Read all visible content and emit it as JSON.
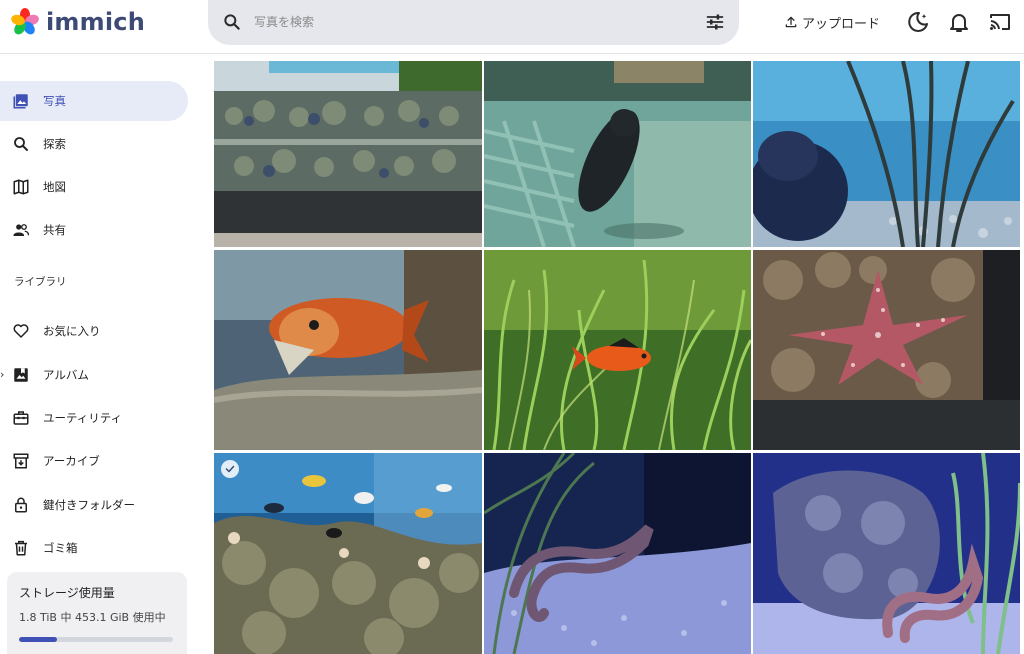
{
  "app": {
    "name": "immich"
  },
  "header": {
    "search_placeholder": "写真を検索",
    "upload_label": "アップロード",
    "icons": {
      "search": "search-icon",
      "filter": "tune-icon",
      "theme": "dark-mode-icon",
      "notifications": "bell-icon",
      "cast": "cast-icon"
    }
  },
  "sidebar": {
    "items": [
      {
        "label": "写真",
        "icon": "photos-icon",
        "active": true
      },
      {
        "label": "探索",
        "icon": "search-icon"
      },
      {
        "label": "地図",
        "icon": "map-icon"
      },
      {
        "label": "共有",
        "icon": "sharing-icon"
      }
    ],
    "library_heading": "ライブラリ",
    "library_items": [
      {
        "label": "お気に入り",
        "icon": "heart-icon"
      },
      {
        "label": "アルバム",
        "icon": "album-icon",
        "expandable": true
      },
      {
        "label": "ユーティリティ",
        "icon": "toolbox-icon"
      },
      {
        "label": "アーカイブ",
        "icon": "archive-icon"
      },
      {
        "label": "鍵付きフォルダー",
        "icon": "lock-icon"
      },
      {
        "label": "ゴミ箱",
        "icon": "trash-icon"
      }
    ],
    "storage": {
      "title": "ストレージ使用量",
      "usage": "1.8 TiB 中 453.1 GiB 使用中",
      "fraction": 0.245
    }
  },
  "photos": [
    {
      "subject": "coral-tanks",
      "selected": false
    },
    {
      "subject": "seal-swimming",
      "selected": false
    },
    {
      "subject": "anemone-seagrass",
      "selected": false
    },
    {
      "subject": "arowana-fish",
      "selected": false
    },
    {
      "subject": "red-fish-plants",
      "selected": false
    },
    {
      "subject": "starfish",
      "selected": false
    },
    {
      "subject": "reef-tank",
      "selected": true
    },
    {
      "subject": "seahorse-sand",
      "selected": false
    },
    {
      "subject": "seahorse-rock",
      "selected": false
    }
  ],
  "colors": {
    "accent": "#3f51b5",
    "active_bg": "#e7eaf7",
    "search_bg": "#e6e7ec",
    "storage_bg": "#f0f0f3"
  }
}
